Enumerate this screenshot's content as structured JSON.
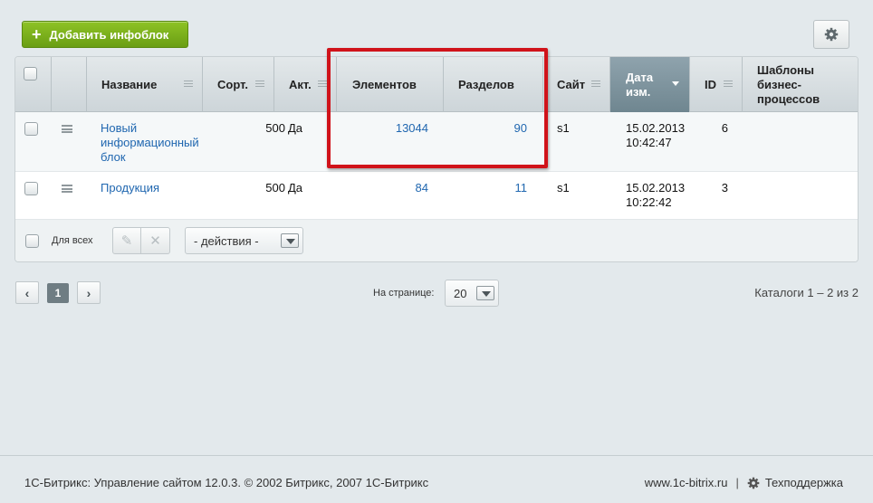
{
  "toolbar": {
    "add_label": "Добавить инфоблок",
    "settings_icon": "gear-icon"
  },
  "grid": {
    "columns": {
      "name": "Название",
      "sort": "Сорт.",
      "active": "Акт.",
      "elements": "Элементов",
      "sections": "Разделов",
      "site": "Сайт",
      "date": "Дата изм.",
      "id": "ID",
      "bp": "Шаблоны бизнес-процессов"
    },
    "rows": [
      {
        "name": "Новый информационный блок",
        "sort": "500",
        "active": "Да",
        "elements": "13044",
        "sections": "90",
        "site": "s1",
        "date": "15.02.2013",
        "time": "10:42:47",
        "id": "6"
      },
      {
        "name": "Продукция",
        "sort": "500",
        "active": "Да",
        "elements": "84",
        "sections": "11",
        "site": "s1",
        "date": "15.02.2013",
        "time": "10:22:42",
        "id": "3"
      }
    ],
    "footer": {
      "for_all": "Для всех",
      "actions": "- действия -"
    }
  },
  "pager": {
    "prev": "‹",
    "current": "1",
    "next": "›",
    "per_page_label": "На странице:",
    "per_page": "20",
    "count": "Каталоги 1 – 2 из 2"
  },
  "footer": {
    "copyright": "1С-Битрикс: Управление сайтом 12.0.3. © 2002 Битрикс, 2007 1С-Битрикс",
    "site_link": "www.1c-bitrix.ru",
    "separator": "|",
    "support": "Техподдержка"
  },
  "colors": {
    "accent_green": "#7ab11c",
    "highlight_red": "#d0131a",
    "link_blue": "#2067b0"
  }
}
